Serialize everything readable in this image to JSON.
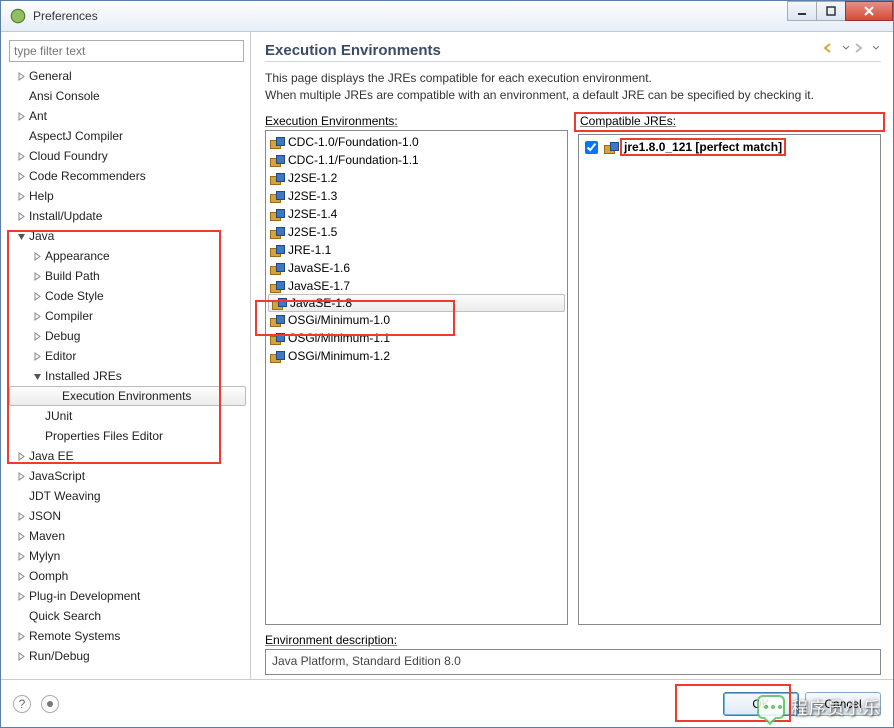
{
  "window": {
    "title": "Preferences"
  },
  "filter": {
    "placeholder": "type filter text"
  },
  "tree": [
    {
      "label": "General",
      "indent": 0,
      "exp": "c"
    },
    {
      "label": "Ansi Console",
      "indent": 0,
      "exp": ""
    },
    {
      "label": "Ant",
      "indent": 0,
      "exp": "c"
    },
    {
      "label": "AspectJ Compiler",
      "indent": 0,
      "exp": ""
    },
    {
      "label": "Cloud Foundry",
      "indent": 0,
      "exp": "c"
    },
    {
      "label": "Code Recommenders",
      "indent": 0,
      "exp": "c"
    },
    {
      "label": "Help",
      "indent": 0,
      "exp": "c"
    },
    {
      "label": "Install/Update",
      "indent": 0,
      "exp": "c"
    },
    {
      "label": "Java",
      "indent": 0,
      "exp": "o"
    },
    {
      "label": "Appearance",
      "indent": 1,
      "exp": "c"
    },
    {
      "label": "Build Path",
      "indent": 1,
      "exp": "c"
    },
    {
      "label": "Code Style",
      "indent": 1,
      "exp": "c"
    },
    {
      "label": "Compiler",
      "indent": 1,
      "exp": "c"
    },
    {
      "label": "Debug",
      "indent": 1,
      "exp": "c"
    },
    {
      "label": "Editor",
      "indent": 1,
      "exp": "c"
    },
    {
      "label": "Installed JREs",
      "indent": 1,
      "exp": "o"
    },
    {
      "label": "Execution Environments",
      "indent": 2,
      "exp": "",
      "sel": true
    },
    {
      "label": "JUnit",
      "indent": 1,
      "exp": ""
    },
    {
      "label": "Properties Files Editor",
      "indent": 1,
      "exp": ""
    },
    {
      "label": "Java EE",
      "indent": 0,
      "exp": "c"
    },
    {
      "label": "JavaScript",
      "indent": 0,
      "exp": "c"
    },
    {
      "label": "JDT Weaving",
      "indent": 0,
      "exp": ""
    },
    {
      "label": "JSON",
      "indent": 0,
      "exp": "c"
    },
    {
      "label": "Maven",
      "indent": 0,
      "exp": "c"
    },
    {
      "label": "Mylyn",
      "indent": 0,
      "exp": "c"
    },
    {
      "label": "Oomph",
      "indent": 0,
      "exp": "c"
    },
    {
      "label": "Plug-in Development",
      "indent": 0,
      "exp": "c"
    },
    {
      "label": "Quick Search",
      "indent": 0,
      "exp": ""
    },
    {
      "label": "Remote Systems",
      "indent": 0,
      "exp": "c"
    },
    {
      "label": "Run/Debug",
      "indent": 0,
      "exp": "c"
    }
  ],
  "page": {
    "title": "Execution Environments",
    "desc1": "This page displays the JREs compatible for each execution environment.",
    "desc2": "When multiple JREs are compatible with an environment, a default JRE can be specified by checking it.",
    "envLabel": "Execution Environments:",
    "jreLabel": "Compatible JREs:",
    "envDescLabel": "Environment description:",
    "envDescValue": "Java Platform, Standard Edition 8.0"
  },
  "environments": [
    "CDC-1.0/Foundation-1.0",
    "CDC-1.1/Foundation-1.1",
    "J2SE-1.2",
    "J2SE-1.3",
    "J2SE-1.4",
    "J2SE-1.5",
    "JRE-1.1",
    "JavaSE-1.6",
    "JavaSE-1.7",
    "JavaSE-1.8",
    "OSGi/Minimum-1.0",
    "OSGi/Minimum-1.1",
    "OSGi/Minimum-1.2"
  ],
  "selectedEnvIndex": 9,
  "compatibleJre": {
    "label": "jre1.8.0_121 [perfect match]",
    "checked": true
  },
  "footer": {
    "ok": "OK",
    "cancel": "Cancel"
  },
  "watermark": "程序员小乐"
}
